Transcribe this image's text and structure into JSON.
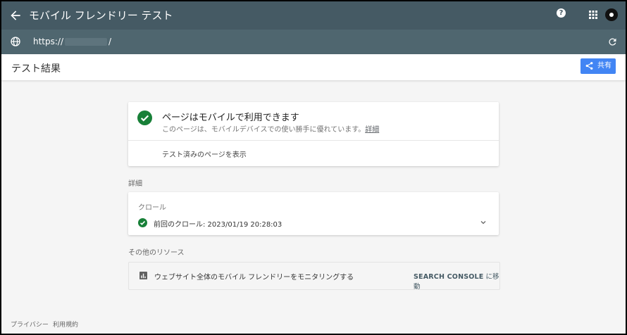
{
  "appbar": {
    "title": "モバイル フレンドリー テスト"
  },
  "urlbar": {
    "prefix": "https://",
    "suffix": "/"
  },
  "header": {
    "title": "テスト結果",
    "share_label": "共有"
  },
  "result": {
    "heading": "ページはモバイルで利用できます",
    "subtext": "このページは、モバイルデバイスでの使い勝手に優れています。",
    "details_link": "詳細",
    "view_tested_page": "テスト済みのページを表示"
  },
  "details": {
    "section_label": "詳細",
    "crawl_label": "クロール",
    "crawl_text": "前回のクロール: 2023/01/19 20:28:03"
  },
  "resources": {
    "section_label": "その他のリソース",
    "item_text": "ウェブサイト全体のモバイル フレンドリーをモニタリングする",
    "link_bold": "SEARCH CONSOLE",
    "link_suffix": " に移動"
  },
  "footer": {
    "privacy": "プライバシー",
    "terms": "利用規約"
  },
  "colors": {
    "appbar": "#455a64",
    "urlbar": "#4f666f",
    "accent": "#4285f4",
    "success": "#188038"
  }
}
